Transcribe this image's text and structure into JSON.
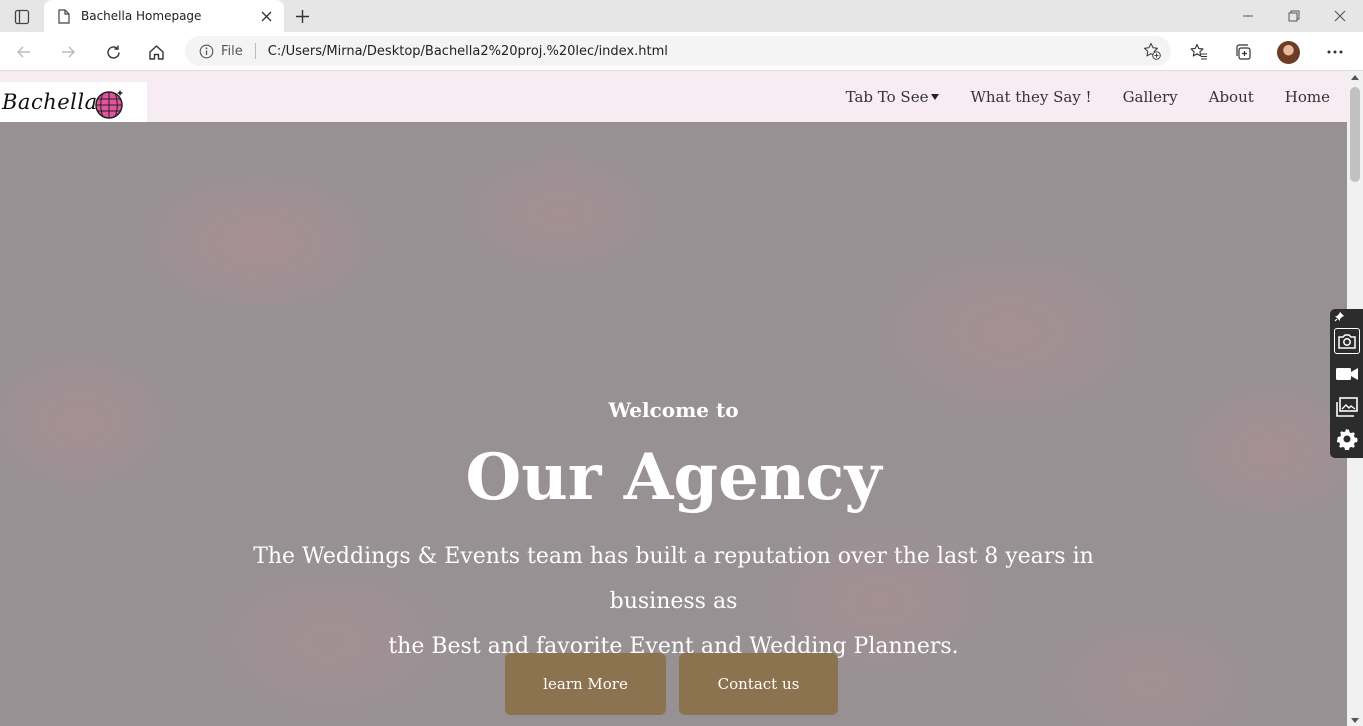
{
  "browser": {
    "tab": {
      "title": "Bachella Homepage"
    },
    "address": {
      "scheme_label": "File",
      "url": "C:/Users/Mirna/Desktop/Bachella2%20proj.%20lec/index.html"
    }
  },
  "site": {
    "logo_text": "Bachella",
    "nav": [
      {
        "label": "Tab To See"
      },
      {
        "label": "What they Say !"
      },
      {
        "label": "Gallery"
      },
      {
        "label": "About"
      },
      {
        "label": "Home"
      }
    ]
  },
  "hero": {
    "kicker": "Welcome to",
    "title": "Our Agency",
    "text_line1": "The Weddings & Events team has built a reputation over the last 8 years in business as",
    "text_line2": "the Best and favorite Event and Wedding Planners.",
    "buttons": [
      {
        "label": "learn More"
      },
      {
        "label": "Contact us"
      }
    ]
  },
  "colors": {
    "hero_button": "#8b7350",
    "nav_background": "#f6ecf1",
    "hero_overlay": "#9b9597"
  },
  "icons": [
    "tab-actions-icon",
    "page-icon",
    "close-icon",
    "plus-icon",
    "minimize-icon",
    "restore-icon",
    "back-icon",
    "forward-icon",
    "refresh-icon",
    "home-icon",
    "info-icon",
    "add-favorite-icon",
    "favorites-icon",
    "collections-icon",
    "more-icon",
    "camera-icon",
    "video-icon",
    "gallery-icon",
    "gear-icon",
    "pin-icon"
  ]
}
